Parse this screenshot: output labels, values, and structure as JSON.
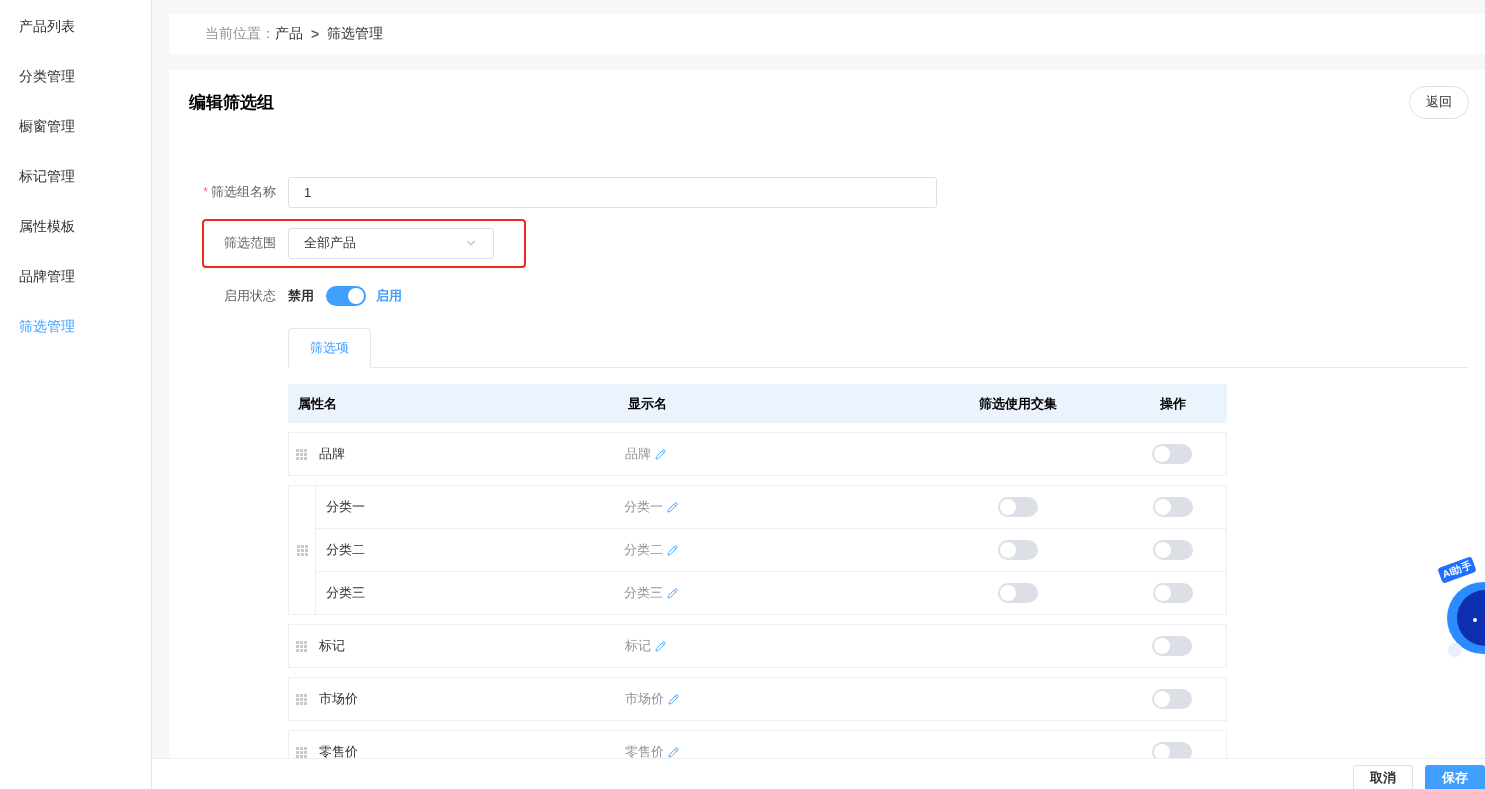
{
  "sidebar": {
    "items": [
      {
        "label": "产品列表",
        "selected": false
      },
      {
        "label": "分类管理",
        "selected": false
      },
      {
        "label": "橱窗管理",
        "selected": false
      },
      {
        "label": "标记管理",
        "selected": false
      },
      {
        "label": "属性模板",
        "selected": false
      },
      {
        "label": "品牌管理",
        "selected": false
      },
      {
        "label": "筛选管理",
        "selected": true
      }
    ]
  },
  "breadcrumb": {
    "prefix": "当前位置：",
    "items": [
      "产品",
      "筛选管理"
    ],
    "separator": ">"
  },
  "page": {
    "title": "编辑筛选组",
    "back_button": "返回"
  },
  "form": {
    "name": {
      "label": "筛选组名称",
      "required_mark": "*",
      "value": "1"
    },
    "scope": {
      "label": "筛选范围",
      "value": "全部产品",
      "highlighted": true
    },
    "status": {
      "label": "启用状态",
      "off_label": "禁用",
      "on_label": "启用",
      "on": true
    }
  },
  "tabs": [
    {
      "label": "筛选项",
      "selected": true
    }
  ],
  "table": {
    "columns": [
      "属性名",
      "显示名",
      "筛选使用交集",
      "操作"
    ],
    "rows": [
      {
        "kind": "single",
        "name": "品牌",
        "display": "品牌",
        "enabled": false
      },
      {
        "kind": "group",
        "children": [
          {
            "name": "分类一",
            "display": "分类一",
            "intersect": false,
            "enabled": false
          },
          {
            "name": "分类二",
            "display": "分类二",
            "intersect": false,
            "enabled": false
          },
          {
            "name": "分类三",
            "display": "分类三",
            "intersect": false,
            "enabled": false
          }
        ]
      },
      {
        "kind": "single",
        "name": "标记",
        "display": "标记",
        "enabled": false
      },
      {
        "kind": "single",
        "name": "市场价",
        "display": "市场价",
        "enabled": false
      },
      {
        "kind": "single",
        "name": "零售价",
        "display": "零售价",
        "enabled": false
      }
    ]
  },
  "footer": {
    "buttons": [
      {
        "label": "取消",
        "primary": false
      },
      {
        "label": "保存",
        "primary": true
      }
    ]
  },
  "assistant": {
    "label": "AI助手"
  }
}
